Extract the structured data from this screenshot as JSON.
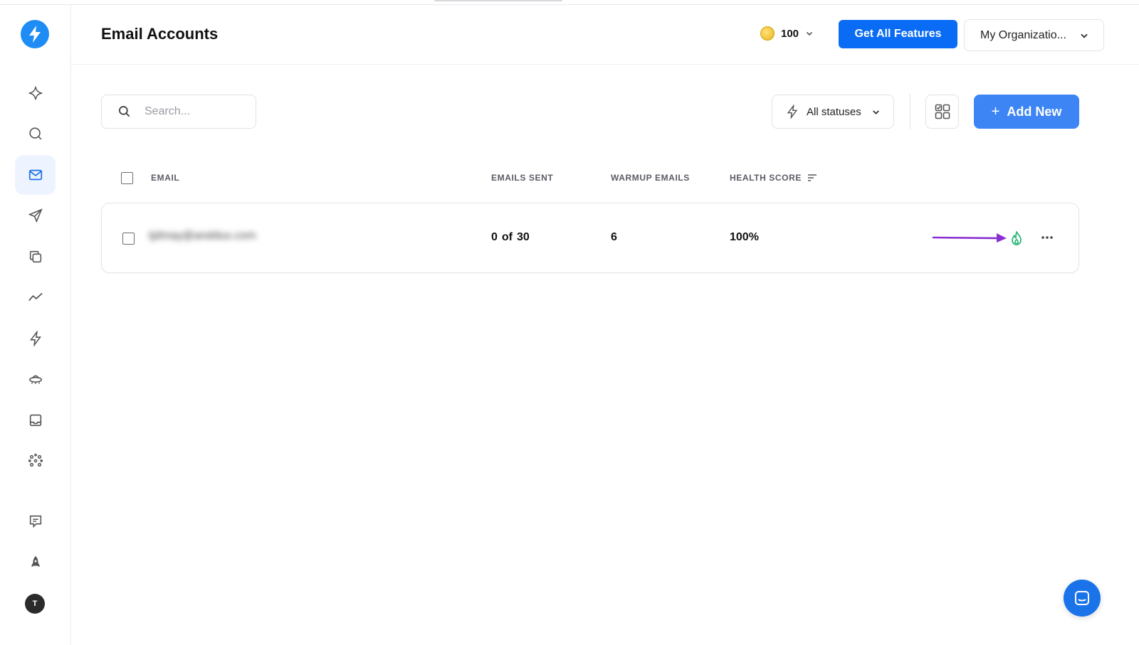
{
  "header": {
    "title": "Email Accounts",
    "credits": "100",
    "get_features_label": "Get All Features",
    "organization": "My Organizatio..."
  },
  "sidebar": {
    "items": [
      {
        "icon": "sparkle-icon",
        "active": false
      },
      {
        "icon": "search-icon",
        "active": false
      },
      {
        "icon": "mail-icon",
        "active": true
      },
      {
        "icon": "send-icon",
        "active": false
      },
      {
        "icon": "copy-icon",
        "active": false
      },
      {
        "icon": "trend-icon",
        "active": false
      },
      {
        "icon": "bolt-icon",
        "active": false
      },
      {
        "icon": "ufo-icon",
        "active": false
      },
      {
        "icon": "inbox-icon",
        "active": false
      },
      {
        "icon": "network-icon",
        "active": false
      },
      {
        "icon": "feedback-icon",
        "active": false
      },
      {
        "icon": "rocket-icon",
        "active": false
      }
    ],
    "avatar_initial": "T"
  },
  "toolbar": {
    "search_placeholder": "Search...",
    "status_filter": "All statuses",
    "add_new_label": "Add New"
  },
  "table": {
    "columns": [
      "EMAIL",
      "EMAILS SENT",
      "WARMUP EMAILS",
      "HEALTH SCORE"
    ],
    "rows": [
      {
        "email": "tjdmay@anddux.com",
        "sent_count": "0",
        "sent_of": "of",
        "sent_limit": "30",
        "warmup_emails": "6",
        "health_score": "100%"
      }
    ]
  },
  "colors": {
    "primary": "#0a6cf5",
    "add_button": "#3d85f5",
    "warmup_flame": "#2fb879",
    "annotation_arrow": "#8a2fd1",
    "chat": "#1a73e8"
  }
}
